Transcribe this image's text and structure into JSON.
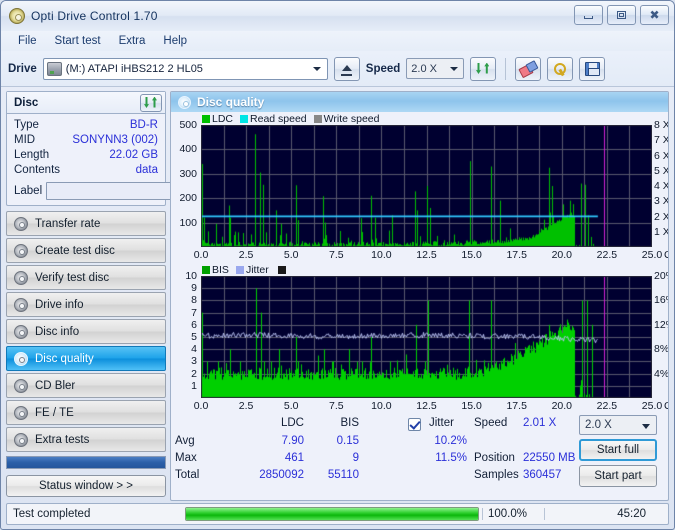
{
  "window": {
    "title": "Opti Drive Control 1.70",
    "app_icon": "disc-icon",
    "buttons": {
      "minimize": "minimize-icon",
      "maximize": "maximize-icon",
      "close": "close-icon"
    }
  },
  "menu": {
    "items": [
      "File",
      "Start test",
      "Extra",
      "Help"
    ]
  },
  "toolbar": {
    "drive_label": "Drive",
    "drive_value": "(M:)  ATAPI iHBS212  2 HL05",
    "eject_icon": "eject-icon",
    "speed_label": "Speed",
    "speed_value": "2.0 X",
    "refresh_icon": "refresh-icon",
    "eraser_icon": "eraser-icon",
    "tools_icon": "tools-icon",
    "save_icon": "save-icon"
  },
  "disc": {
    "title": "Disc",
    "refresh_icon": "refresh-icon",
    "rows": [
      {
        "key": "Type",
        "value": "BD-R"
      },
      {
        "key": "MID",
        "value": "SONYNN3 (002)"
      },
      {
        "key": "Length",
        "value": "22.02 GB"
      },
      {
        "key": "Contents",
        "value": "data"
      }
    ],
    "label_key": "Label",
    "label_value": "",
    "label_button_icon": "cd-icon"
  },
  "sidebar": {
    "items": [
      {
        "label": "Transfer rate",
        "active": false
      },
      {
        "label": "Create test disc",
        "active": false
      },
      {
        "label": "Verify test disc",
        "active": false
      },
      {
        "label": "Drive info",
        "active": false
      },
      {
        "label": "Disc info",
        "active": false
      },
      {
        "label": "Disc quality",
        "active": true
      },
      {
        "label": "CD Bler",
        "active": false
      },
      {
        "label": "FE / TE",
        "active": false
      },
      {
        "label": "Extra tests",
        "active": false
      }
    ],
    "status_button": "Status window > >"
  },
  "content": {
    "title": "Disc quality",
    "icon": "disc-quality-icon"
  },
  "stats": {
    "col_ldc": "LDC",
    "col_bis": "BIS",
    "jitter_label": "Jitter",
    "jitter_checked": true,
    "row_avg": "Avg",
    "row_max": "Max",
    "row_total": "Total",
    "ldc_avg": "7.90",
    "ldc_max": "461",
    "ldc_total": "2850092",
    "bis_avg": "0.15",
    "bis_max": "9",
    "bis_total": "55110",
    "jitter_avg": "10.2%",
    "jitter_max": "11.5%",
    "speed_label": "Speed",
    "speed_value": "2.01 X",
    "position_label": "Position",
    "position_value": "22550 MB",
    "samples_label": "Samples",
    "samples_value": "360457",
    "speed_select": "2.0 X",
    "start_full": "Start full",
    "start_part": "Start part"
  },
  "statusbar": {
    "text": "Test completed",
    "percent_label": "100.0%",
    "percent_value": 100,
    "elapsed": "45:20"
  },
  "chart_data": [
    {
      "type": "line",
      "id": "ldc-chart",
      "title": "",
      "xlabel": "GB",
      "ylabel": "LDC",
      "xlim": [
        0,
        25
      ],
      "ylim": [
        0,
        500
      ],
      "y2lim": [
        0,
        8
      ],
      "y2label": "X",
      "grid": true,
      "legend": [
        "LDC",
        "Read speed",
        "Write speed"
      ],
      "legend_colors": [
        "#00c000",
        "#00e5e5",
        "#888888"
      ],
      "xticks": [
        "0.0",
        "2.5",
        "5.0",
        "7.5",
        "10.0",
        "12.5",
        "15.0",
        "17.5",
        "20.0",
        "22.5",
        "25.0"
      ],
      "yticks": [
        100,
        200,
        300,
        400,
        500
      ],
      "y2ticks": [
        "1 X",
        "2 X",
        "3 X",
        "4 X",
        "5 X",
        "6 X",
        "7 X",
        "8 X"
      ],
      "data_end_gb": 22.0,
      "marker_gb": 22.35,
      "series": [
        {
          "name": "LDC",
          "color": "#00c000",
          "baseline": [
            8,
            9,
            10,
            9,
            11,
            10,
            9,
            12,
            10,
            9,
            11,
            13,
            10,
            9,
            12,
            11,
            10,
            9,
            11,
            12,
            10,
            11,
            9,
            12,
            10,
            11,
            13,
            10,
            9,
            11,
            12,
            10,
            9,
            11,
            10,
            12,
            11,
            9,
            10,
            12,
            11,
            10,
            12,
            11,
            9,
            10,
            12,
            11,
            13,
            10,
            11,
            12,
            10,
            11,
            13,
            12,
            11,
            10,
            12,
            13,
            11,
            12,
            14,
            13,
            12,
            11,
            13,
            14,
            12,
            13,
            15,
            14,
            13,
            15,
            16,
            15,
            14,
            16,
            17,
            16,
            18,
            17,
            19,
            18,
            20,
            19,
            21,
            22,
            21,
            23,
            25,
            24,
            26,
            28,
            27,
            30,
            32,
            34,
            38,
            42,
            48,
            55,
            62,
            70,
            78,
            86,
            94,
            102,
            110,
            120,
            128,
            135,
            128,
            0,
            0,
            0,
            0,
            0,
            0,
            0
          ],
          "spikes": [
            {
              "gb": 0.08,
              "v": 340
            },
            {
              "gb": 0.18,
              "v": 120
            },
            {
              "gb": 0.85,
              "v": 95
            },
            {
              "gb": 1.55,
              "v": 170
            },
            {
              "gb": 1.62,
              "v": 120
            },
            {
              "gb": 2.05,
              "v": 60
            },
            {
              "gb": 3.02,
              "v": 462
            },
            {
              "gb": 3.28,
              "v": 305
            },
            {
              "gb": 3.42,
              "v": 255
            },
            {
              "gb": 4.18,
              "v": 150
            },
            {
              "gb": 4.42,
              "v": 95
            },
            {
              "gb": 5.25,
              "v": 253
            },
            {
              "gb": 5.38,
              "v": 110
            },
            {
              "gb": 6.75,
              "v": 208
            },
            {
              "gb": 6.88,
              "v": 100
            },
            {
              "gb": 8.85,
              "v": 118
            },
            {
              "gb": 9.45,
              "v": 210
            },
            {
              "gb": 9.62,
              "v": 120
            },
            {
              "gb": 10.6,
              "v": 130
            },
            {
              "gb": 11.85,
              "v": 228
            },
            {
              "gb": 11.95,
              "v": 150
            },
            {
              "gb": 12.55,
              "v": 250
            },
            {
              "gb": 12.7,
              "v": 160
            },
            {
              "gb": 14.9,
              "v": 352
            },
            {
              "gb": 16.1,
              "v": 330
            },
            {
              "gb": 16.55,
              "v": 190
            },
            {
              "gb": 19.3,
              "v": 325
            },
            {
              "gb": 19.45,
              "v": 250
            },
            {
              "gb": 20.45,
              "v": 190
            },
            {
              "gb": 21.05,
              "v": 260
            },
            {
              "gb": 21.3,
              "v": 255
            },
            {
              "gb": 21.45,
              "v": 130
            }
          ]
        },
        {
          "name": "Read speed",
          "color": "#2fc8ff",
          "value_x": 2.01,
          "note": "flat horizontal line at about 2 X across whole scanned range"
        }
      ]
    },
    {
      "type": "line",
      "id": "bis-jitter-chart",
      "title": "",
      "xlabel": "GB",
      "ylabel": "BIS",
      "xlim": [
        0,
        25
      ],
      "ylim": [
        0,
        10
      ],
      "y2lim": [
        0,
        20
      ],
      "y2label": "%",
      "grid": true,
      "legend": [
        "BIS",
        "Jitter"
      ],
      "legend_colors": [
        "#00a000",
        "#9aa8ee"
      ],
      "xticks": [
        "0.0",
        "2.5",
        "5.0",
        "7.5",
        "10.0",
        "12.5",
        "15.0",
        "17.5",
        "20.0",
        "22.5",
        "25.0"
      ],
      "yticks": [
        1,
        2,
        3,
        4,
        5,
        6,
        7,
        8,
        9,
        10
      ],
      "y2ticks": [
        "4%",
        "8%",
        "12%",
        "16%",
        "20%"
      ],
      "data_end_gb": 22.0,
      "marker_gb": 22.35,
      "series": [
        {
          "name": "BIS",
          "color": "#00d000",
          "baseline": [
            2,
            2,
            2,
            2,
            2,
            2,
            2,
            2,
            2,
            2,
            2,
            2,
            2,
            2,
            2,
            2,
            2,
            2,
            2,
            2,
            2,
            2,
            2,
            2,
            2,
            2,
            2,
            2,
            2,
            2,
            2,
            2,
            2,
            2,
            2,
            2,
            2,
            2,
            2,
            2,
            2,
            2,
            2,
            2,
            2,
            2,
            2,
            2,
            2,
            2,
            2,
            2,
            2,
            2,
            2,
            2,
            2,
            2,
            2,
            2,
            2,
            2,
            2,
            2,
            2,
            2,
            2,
            2,
            2,
            2,
            2,
            2,
            2,
            2,
            2,
            2,
            2,
            2,
            2,
            2,
            2,
            2,
            2,
            2,
            2.2,
            2.2,
            2.4,
            2.4,
            2.6,
            2.6,
            2.8,
            3,
            3,
            3.2,
            3.2,
            3.4,
            3.6,
            3.8,
            4,
            4.2,
            4.2,
            4.4,
            4.6,
            4.6,
            4.8,
            5,
            5.2,
            5.4,
            5.6,
            5.8,
            6,
            6,
            6,
            0,
            0,
            0,
            0,
            0,
            0,
            0
          ],
          "spikes": [
            {
              "gb": 0.08,
              "v": 7
            },
            {
              "gb": 0.35,
              "v": 3
            },
            {
              "gb": 0.95,
              "v": 3
            },
            {
              "gb": 1.6,
              "v": 4
            },
            {
              "gb": 2.15,
              "v": 3
            },
            {
              "gb": 3.05,
              "v": 9
            },
            {
              "gb": 3.3,
              "v": 7
            },
            {
              "gb": 3.5,
              "v": 3
            },
            {
              "gb": 3.9,
              "v": 3
            },
            {
              "gb": 4.3,
              "v": 4
            },
            {
              "gb": 5.25,
              "v": 5
            },
            {
              "gb": 5.4,
              "v": 3
            },
            {
              "gb": 6.8,
              "v": 4
            },
            {
              "gb": 7.3,
              "v": 3
            },
            {
              "gb": 8.2,
              "v": 4
            },
            {
              "gb": 8.9,
              "v": 3
            },
            {
              "gb": 9.4,
              "v": 5
            },
            {
              "gb": 10.5,
              "v": 3
            },
            {
              "gb": 11.9,
              "v": 6
            },
            {
              "gb": 12.4,
              "v": 3
            },
            {
              "gb": 12.6,
              "v": 8
            },
            {
              "gb": 14.85,
              "v": 8
            },
            {
              "gb": 16.1,
              "v": 8
            },
            {
              "gb": 19.3,
              "v": 6
            },
            {
              "gb": 19.5,
              "v": 5
            },
            {
              "gb": 20.5,
              "v": 5
            },
            {
              "gb": 21.1,
              "v": 8
            },
            {
              "gb": 21.4,
              "v": 8
            },
            {
              "gb": 21.7,
              "v": 6
            }
          ]
        },
        {
          "name": "Jitter",
          "color": "#b9c2f2",
          "avg_percent": 10.2,
          "max_percent": 11.5,
          "note": "noisy near-flat trace around 10.2%, drifting slightly down toward the end"
        }
      ]
    }
  ]
}
